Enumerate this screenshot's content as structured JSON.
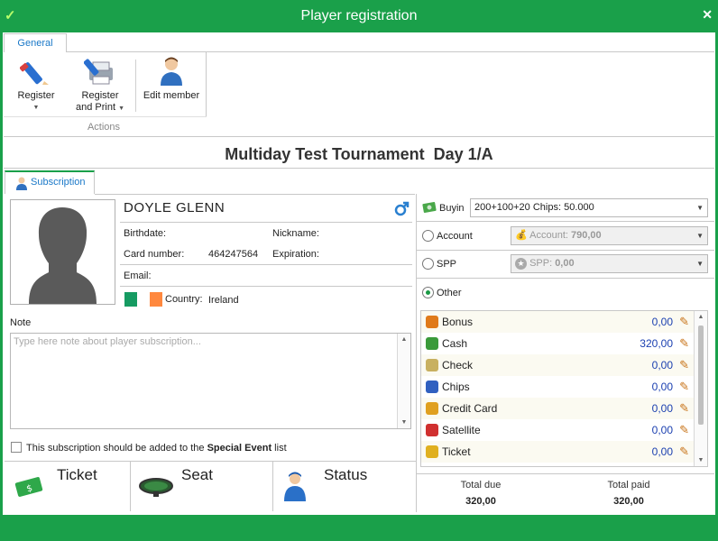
{
  "window": {
    "title": "Player registration"
  },
  "ribbon": {
    "tab_label": "General",
    "register_label": "Register",
    "register_print_line1": "Register",
    "register_print_line2": "and Print",
    "edit_member_label": "Edit member",
    "group_label": "Actions"
  },
  "tournament": {
    "title": "Multiday Test Tournament  Day 1/A"
  },
  "subscription_tab": {
    "label": "Subscription"
  },
  "player": {
    "name": "DOYLE GLENN",
    "birthdate_label": "Birthdate:",
    "nickname_label": "Nickname:",
    "card_number_label": "Card number:",
    "card_number_value": "464247564",
    "expiration_label": "Expiration:",
    "email_label": "Email:",
    "country_label": "Country:",
    "country_value": "Ireland",
    "flag_colors": [
      "#169b62",
      "#ffffff",
      "#ff883e"
    ]
  },
  "note": {
    "label": "Note",
    "placeholder": "Type here note about player subscription..."
  },
  "special_event": {
    "text_before": "This subscription should be added to the ",
    "text_bold": "Special Event",
    "text_after": " list"
  },
  "tiles": [
    {
      "label": "Ticket",
      "icon": "ticket-icon"
    },
    {
      "label": "Seat",
      "icon": "poker-table-icon"
    },
    {
      "label": "Status",
      "icon": "person-icon"
    }
  ],
  "buyin": {
    "label": "Buyin",
    "value": "200+100+20 Chips: 50.000"
  },
  "account": {
    "label": "Account",
    "combo_prefix": "Account: ",
    "combo_value": "790,00"
  },
  "spp": {
    "label": "SPP",
    "combo_prefix": "SPP: ",
    "combo_value": "0,00"
  },
  "other": {
    "label": "Other",
    "selected": true
  },
  "payments": [
    {
      "name": "Bonus",
      "value": "0,00",
      "color": "#e07a1a",
      "icon": "gift-icon"
    },
    {
      "name": "Cash",
      "value": "320,00",
      "color": "#3a9a3a",
      "icon": "cash-icon"
    },
    {
      "name": "Check",
      "value": "0,00",
      "color": "#c8b060",
      "icon": "check-icon"
    },
    {
      "name": "Chips",
      "value": "0,00",
      "color": "#3060c0",
      "icon": "chips-icon"
    },
    {
      "name": "Credit Card",
      "value": "0,00",
      "color": "#e0a020",
      "icon": "credit-card-icon"
    },
    {
      "name": "Satellite",
      "value": "0,00",
      "color": "#d03030",
      "icon": "satellite-icon"
    },
    {
      "name": "Ticket",
      "value": "0,00",
      "color": "#e0b020",
      "icon": "ticket-icon"
    }
  ],
  "totals": {
    "due_label": "Total due",
    "due_value": "320,00",
    "paid_label": "Total paid",
    "paid_value": "320,00"
  }
}
